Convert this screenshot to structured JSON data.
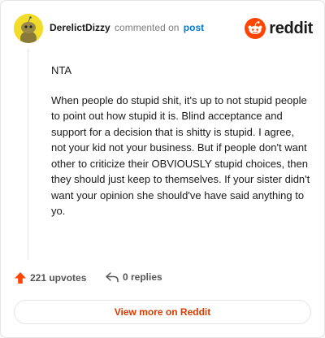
{
  "header": {
    "username": "DerelictDizzy",
    "action_text": "commented on",
    "post_link": "post",
    "brand": "reddit"
  },
  "comment": {
    "paragraphs": [
      "NTA",
      "When people do stupid shit, it's up to not stupid people to point out how stupid it is. Blind acceptance and support for a decision that is shitty is stupid. I agree, not your kid not your business. But if people don't want other to criticize their OBVIOUSLY stupid choices, then they should just keep to themselves. If your sister didn't want your opinion she should've have said anything to yo."
    ]
  },
  "actions": {
    "upvotes": "221 upvotes",
    "replies": "0 replies"
  },
  "footer": {
    "view_more": "View more on Reddit"
  },
  "colors": {
    "accent": "#ff4500",
    "link": "#0079d3",
    "view_more": "#d93a00",
    "avatar_bg": "#f2dc2b"
  }
}
